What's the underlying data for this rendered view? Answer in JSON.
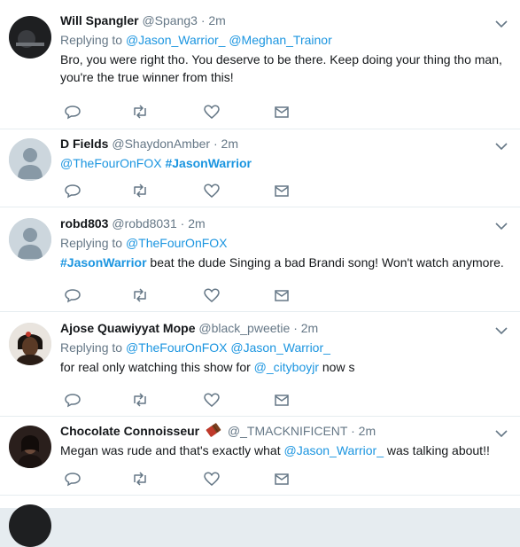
{
  "tweets": [
    {
      "name": "Will Spangler",
      "handle": "@Spang3",
      "dot": "·",
      "time": "2m",
      "replying_prefix": "Replying to",
      "replying_to": [
        "@Jason_Warrior_",
        "@Meghan_Trainor"
      ],
      "text": "Bro, you were right tho. You deserve to be there. Keep doing your thing tho man, you're the true winner from this!"
    },
    {
      "name": "D Fields",
      "handle": "@ShaydonAmber",
      "dot": "·",
      "time": "2m",
      "text_mention": "@TheFourOnFOX",
      "text_hashtag": "#JasonWarrior"
    },
    {
      "name": "robd803",
      "handle": "@robd8031",
      "dot": "·",
      "time": "2m",
      "replying_prefix": "Replying to",
      "replying_to": [
        "@TheFourOnFOX"
      ],
      "text_hashtag": "#JasonWarrior",
      "text_rest": " beat the dude Singing a bad Brandi song! Won't watch anymore."
    },
    {
      "name": "Ajose Quawiyyat Mope",
      "handle": "@black_pweetie",
      "dot": "·",
      "time": "2m",
      "replying_prefix": "Replying to",
      "replying_to": [
        "@TheFourOnFOX",
        "@Jason_Warrior_"
      ],
      "text_before": "for real only watching this show for ",
      "text_mention": "@_cityboyjr",
      "text_after": " now s"
    },
    {
      "name": "Chocolate Connoisseur",
      "handle": "@_TMACKNIFICENT",
      "dot": "·",
      "time": "2m",
      "text_before": "Megan was rude and that's exactly what ",
      "text_mention": "@Jason_Warrior_",
      "text_after": " was talking about!!"
    }
  ],
  "icons": {
    "reply": "reply-icon",
    "retweet": "retweet-icon",
    "like": "heart-icon",
    "dm": "envelope-icon",
    "caret": "chevron-down-icon"
  },
  "colors": {
    "link": "#1b95e0",
    "muted": "#657786",
    "icon": "#657786",
    "border": "#e6ecf0"
  }
}
